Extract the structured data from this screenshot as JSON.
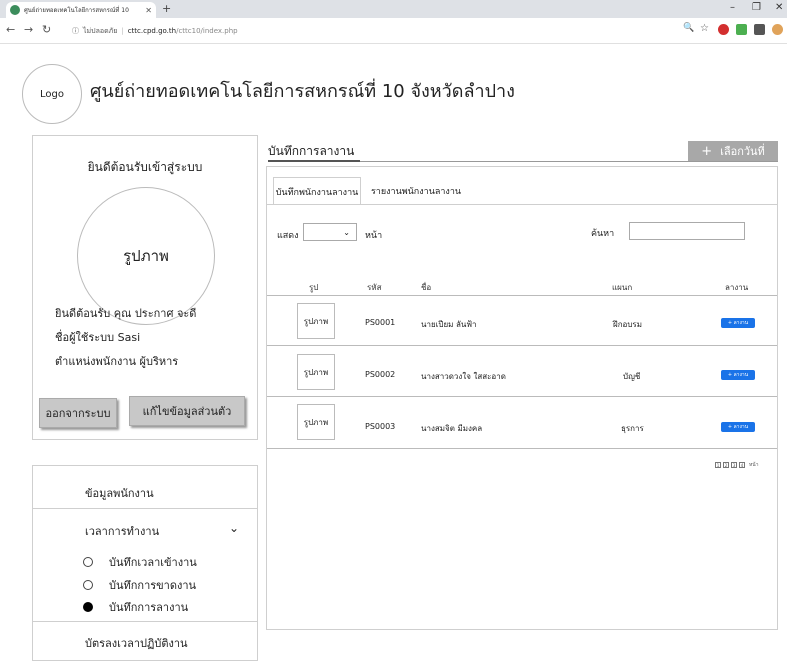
{
  "browser": {
    "tab_title": "ศูนย์ถ่ายทอดเทคโนโลยีการสหกรณ์ที่ 10",
    "new_tab": "+",
    "url_security": "ไม่ปลอดภัย",
    "url_host": "cttc.cpd.go.th",
    "url_path": "/cttc10/index.php"
  },
  "header": {
    "logo": "Logo",
    "title": "ศูนย์ถ่ายทอดเทคโนโลยีการสหกรณ์ที่ 10 จังหวัดลำปาง"
  },
  "welcome": {
    "title": "ยินดีต้อนรับเข้าสู่ระบบ",
    "avatar": "รูปภาพ",
    "greeting": "ยินดีต้อนรับ คุณ ประกาศ จะดี",
    "username_line": "ชื่อผู้ใช้ระบบ Sasi",
    "position_line": "ตำแหน่งพนักงาน ผู้บริหาร",
    "logout": "ออกจากระบบ",
    "edit_profile": "แก้ไขข้อมูลส่วนตัว"
  },
  "menu": {
    "employee_data": "ข้อมูลพนักงาน",
    "work_time": "เวลาการทำงาน",
    "work_time_items": [
      {
        "label": "บันทึกเวลาเข้างาน",
        "selected": false
      },
      {
        "label": "บันทึกการขาดงาน",
        "selected": false
      },
      {
        "label": "บันทึกการลางาน",
        "selected": true
      }
    ],
    "timecard": "บัตรลงเวลาปฏิบัติงาน"
  },
  "main": {
    "title": "บันทึกการลางาน",
    "pick_date": "เลือกวันที่",
    "tabs": [
      "บันทึกพนักงานลางาน",
      "รายงานพนักงานลางาน"
    ],
    "show_label": "แสดง",
    "page_label": "หน้า",
    "search_label": "ค้นหา",
    "columns": [
      "รูป",
      "รหัส",
      "ชื่อ",
      "แผนก",
      "ลางาน"
    ],
    "rows": [
      {
        "photo": "รูปภาพ",
        "code": "PS0001",
        "name": "นายเปียม ลันฟ้า",
        "dept": "ฝึกอบรม",
        "action": "+ ลางาน"
      },
      {
        "photo": "รูปภาพ",
        "code": "PS0002",
        "name": "นางสาวดวงใจ ใสสะอาด",
        "dept": "บัญชี",
        "action": "+ ลางาน"
      },
      {
        "photo": "รูปภาพ",
        "code": "PS0003",
        "name": "นางสมจิต มีมงคล",
        "dept": "ธุรการ",
        "action": "+ ลางาน"
      }
    ],
    "pager_pages": [
      "1",
      "2",
      "3",
      "4"
    ],
    "pager_label": "หน้า"
  }
}
